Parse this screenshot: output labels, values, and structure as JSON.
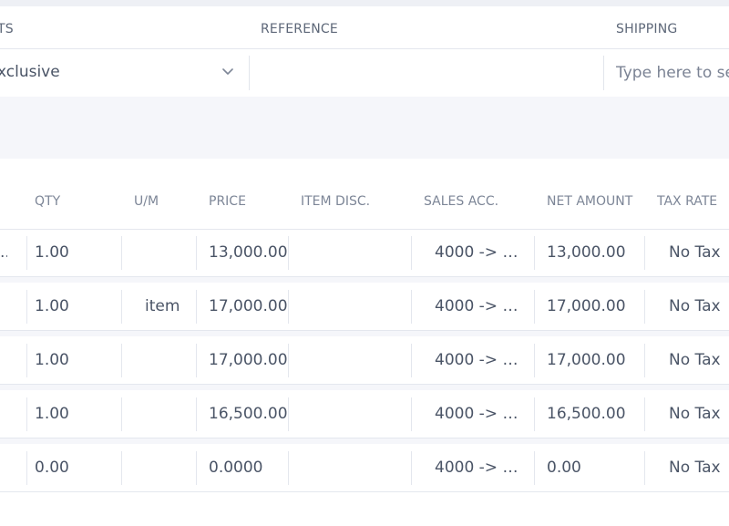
{
  "header": {
    "labels": {
      "amounts": "TS",
      "reference": "REFERENCE",
      "shipping": "SHIPPING"
    }
  },
  "fields": {
    "tax_mode": {
      "value": "xclusive"
    },
    "reference": {
      "value": ""
    },
    "shipping": {
      "placeholder": "Type here to se"
    }
  },
  "table": {
    "columns": {
      "qty": "QTY",
      "um": "U/M",
      "price": "PRICE",
      "item_disc": "ITEM DISC.",
      "sales_acc": "SALES ACC.",
      "net_amount": "NET AMOUNT",
      "tax_rate": "TAX RATE"
    },
    "rows": [
      {
        "lead": "..",
        "qty": "1.00",
        "um": "",
        "price": "13,000.00",
        "item_disc": "",
        "sales_acc": "4000 -> Sa...",
        "net_amount": "13,000.00",
        "tax_rate": "No Tax"
      },
      {
        "lead": "",
        "qty": "1.00",
        "um": "item",
        "price": "17,000.00",
        "item_disc": "",
        "sales_acc": "4000 -> Sa...",
        "net_amount": "17,000.00",
        "tax_rate": "No Tax"
      },
      {
        "lead": "",
        "qty": "1.00",
        "um": "",
        "price": "17,000.00",
        "item_disc": "",
        "sales_acc": "4000 -> Sa...",
        "net_amount": "17,000.00",
        "tax_rate": "No Tax"
      },
      {
        "lead": "",
        "qty": "1.00",
        "um": "",
        "price": "16,500.00",
        "item_disc": "",
        "sales_acc": "4000 -> Sa...",
        "net_amount": "16,500.00",
        "tax_rate": "No Tax"
      },
      {
        "lead": "",
        "qty": "0.00",
        "um": "",
        "price": "0.0000",
        "item_disc": "",
        "sales_acc": "4000 -> Sa...",
        "net_amount": "0.00",
        "tax_rate": "No Tax"
      }
    ]
  },
  "icons": {
    "dropdown": "chevron-down-icon"
  }
}
